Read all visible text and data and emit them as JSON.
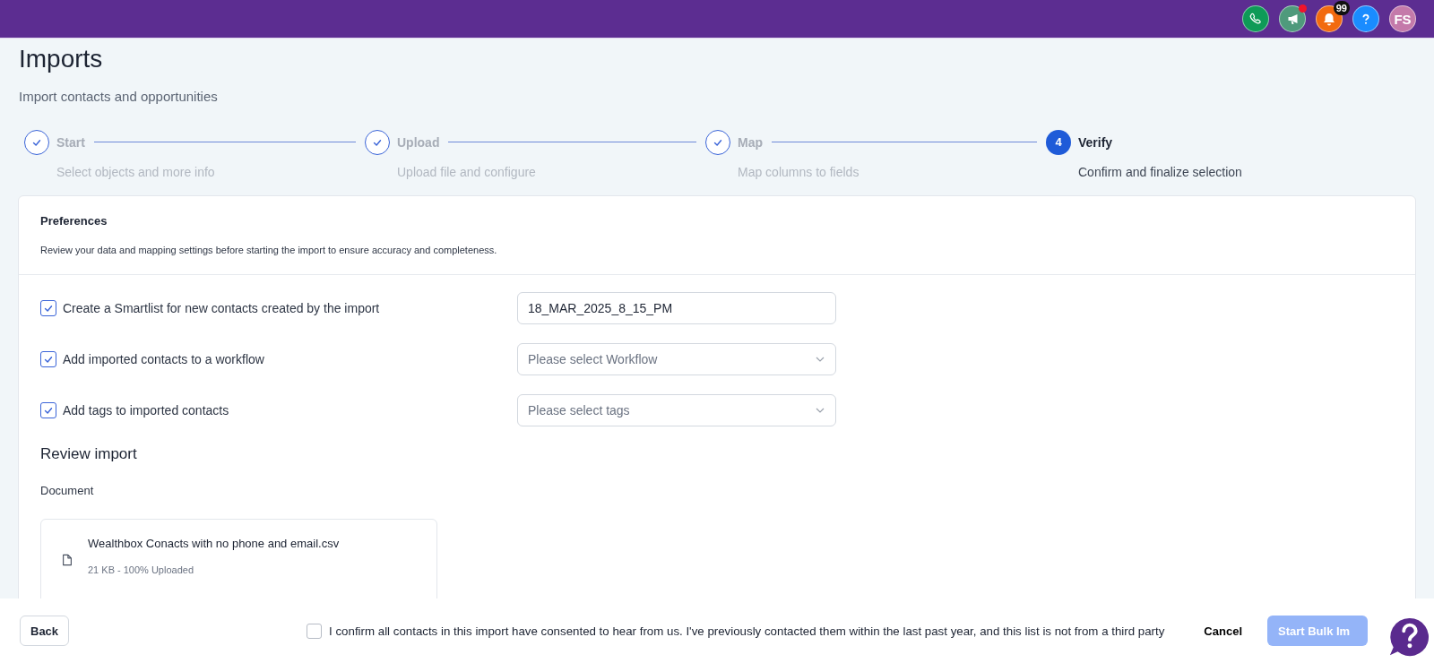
{
  "topbar": {
    "icons": [
      {
        "kind": "phone",
        "color": "#0e9a57"
      },
      {
        "kind": "megaphone",
        "color": "#4f9a7c",
        "dot": true
      },
      {
        "kind": "bell",
        "color": "#f26a0f",
        "badge": "99"
      },
      {
        "kind": "help",
        "color": "#1a8cff"
      },
      {
        "kind": "avatar",
        "color": "#c47aaa",
        "initials": "FS"
      }
    ]
  },
  "page": {
    "title": "Imports",
    "subtitle": "Import contacts and opportunities"
  },
  "steps": [
    {
      "label": "Start",
      "description": "Select objects and more info",
      "completed": true
    },
    {
      "label": "Upload",
      "description": "Upload file and configure",
      "completed": true
    },
    {
      "label": "Map",
      "description": "Map columns to fields",
      "completed": true
    },
    {
      "label": "Verify",
      "description": "Confirm and finalize selection",
      "completed": false,
      "number": "4"
    }
  ],
  "preferences": {
    "title": "Preferences",
    "description": "Review your data and mapping settings before starting the import to ensure accuracy and completeness.",
    "options": [
      {
        "label": "Create a Smartlist for new contacts created by the import",
        "checked": true,
        "field": {
          "kind": "text",
          "value": "18_MAR_2025_8_15_PM"
        }
      },
      {
        "label": "Add imported contacts to a workflow",
        "checked": true,
        "field": {
          "kind": "select",
          "placeholder": "Please select Workflow"
        }
      },
      {
        "label": "Add tags to imported contacts",
        "checked": true,
        "field": {
          "kind": "select",
          "placeholder": "Please select tags"
        }
      }
    ]
  },
  "review": {
    "title": "Review import",
    "document_label": "Document",
    "file": {
      "name": "Wealthbox Conacts with no phone and email.csv",
      "meta": "21 KB - 100% Uploaded"
    }
  },
  "footer": {
    "back": "Back",
    "consent": {
      "label": "I confirm all contacts in this import have consented to hear from us. I've previously contacted them within the last past year, and this list is not from a third party",
      "checked": false
    },
    "cancel": "Cancel",
    "start": {
      "label": "Start Bulk Im",
      "disabled": true
    }
  }
}
